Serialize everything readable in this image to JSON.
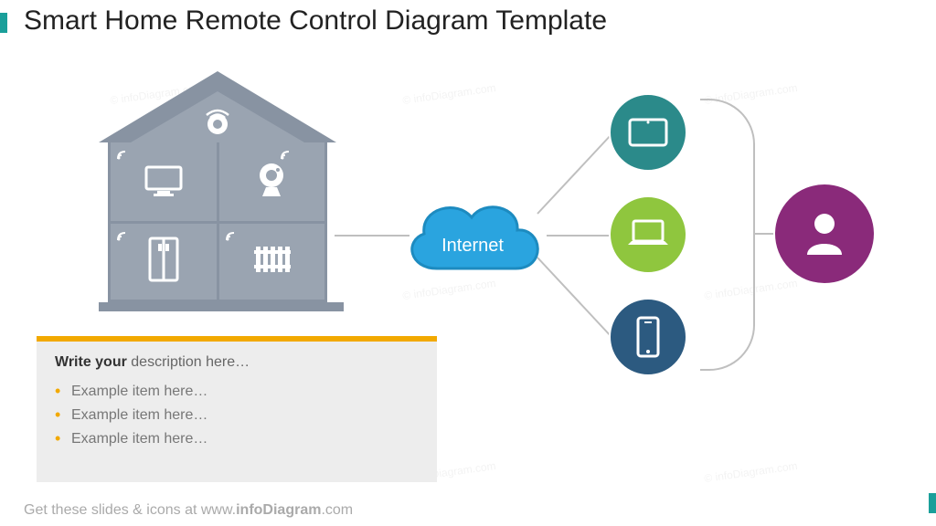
{
  "title": "Smart Home Remote Control Diagram Template",
  "cloud_label": "Internet",
  "description": {
    "heading_bold": "Write your",
    "heading_rest": " description  here…",
    "items": [
      "Example item here…",
      "Example item here…",
      "Example item here…"
    ]
  },
  "footer": {
    "pre": "Get these slides & icons at www.",
    "bold": "infoDiagram",
    "post": ".com"
  },
  "icons": {
    "attic": "smoke-detector-icon",
    "room_tl": "tv-icon",
    "room_tr": "webcam-icon",
    "room_bl": "fridge-icon",
    "room_br": "radiator-icon",
    "circle1": "tablet-icon",
    "circle2": "laptop-icon",
    "circle3": "smartphone-icon",
    "circle4": "person-icon"
  },
  "colors": {
    "cloud": "#2aa4df",
    "tablet": "#2b8a8a",
    "laptop": "#8fc63e",
    "phone": "#2c5a80",
    "user": "#8a2a7a",
    "accent": "#1a9f9a",
    "orange": "#f2a900"
  },
  "watermark": "© infoDiagram.com"
}
